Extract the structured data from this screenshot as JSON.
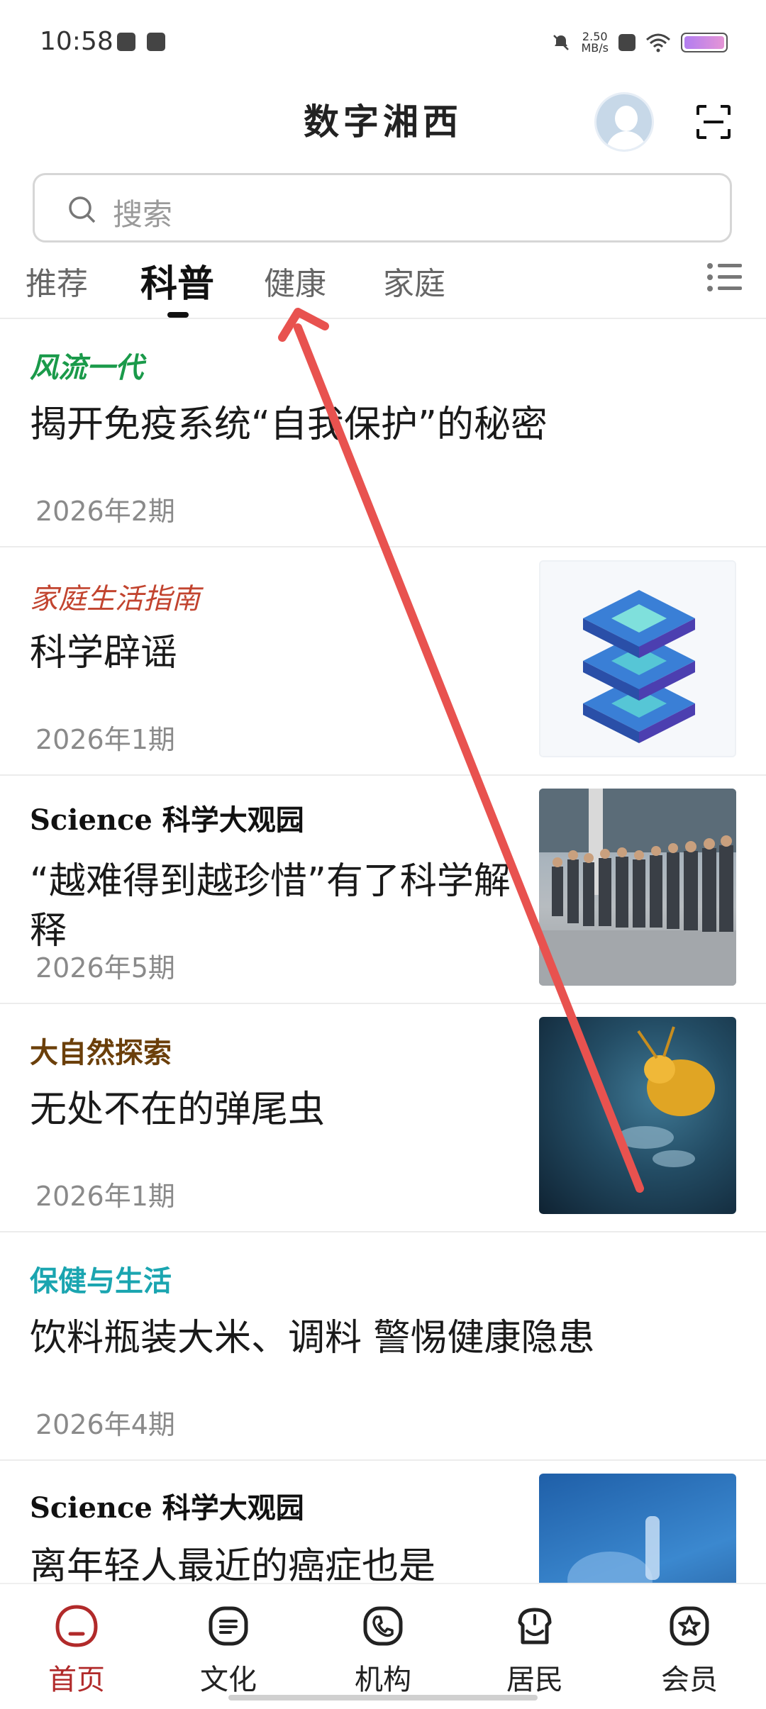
{
  "status_bar": {
    "time": "10:58",
    "speed": "2.50",
    "speed_unit": "MB/s"
  },
  "header": {
    "title": "数字湘西"
  },
  "search": {
    "placeholder": "搜索"
  },
  "tabs": [
    {
      "label": "推荐",
      "active": false
    },
    {
      "label": "科普",
      "active": true
    },
    {
      "label": "健康",
      "active": false
    },
    {
      "label": "家庭",
      "active": false
    }
  ],
  "articles": [
    {
      "source": "风流一代",
      "title": "揭开免疫系统“自我保护”的秘密",
      "issue": "2026年2期",
      "thumbnail": null
    },
    {
      "source": "家庭生活指南",
      "title": "科学辟谣",
      "issue": "2026年1期",
      "thumbnail": "chip-stack-image"
    },
    {
      "source": "Science 科学大观园",
      "title": "“越难得到越珍惜”有了科学解释",
      "issue": "2026年5期",
      "thumbnail": "crowd-queue-photo"
    },
    {
      "source": "大自然探索",
      "title": "无处不在的弹尾虫",
      "issue": "2026年1期",
      "thumbnail": "springtail-macro-photo"
    },
    {
      "source": "保健与生活",
      "title": "饮料瓶装大米、调料 警惕健康隐患",
      "issue": "2026年4期",
      "thumbnail": null
    },
    {
      "source": "Science 科学大观园",
      "title": "离年轻人最近的癌症也是",
      "issue": "",
      "thumbnail": "lab-blue-photo"
    }
  ],
  "bottom_nav": [
    {
      "label": "首页",
      "icon": "home-icon",
      "active": true
    },
    {
      "label": "文化",
      "icon": "document-icon",
      "active": false
    },
    {
      "label": "机构",
      "icon": "phone-icon",
      "active": false
    },
    {
      "label": "居民",
      "icon": "residents-icon",
      "active": false
    },
    {
      "label": "会员",
      "icon": "member-star-icon",
      "active": false
    }
  ],
  "colors": {
    "accent": "#b12a2a",
    "arrow": "#e8524f"
  }
}
